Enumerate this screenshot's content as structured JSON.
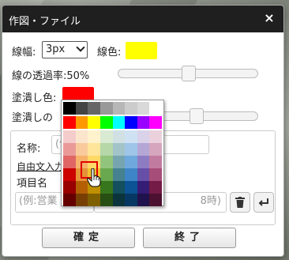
{
  "dialog": {
    "title": "作図・ファイル",
    "close_glyph": "×"
  },
  "line": {
    "width_label": "線幅:",
    "width_value": "3px",
    "color_label": "線色:",
    "color": "#ffff00"
  },
  "line_opacity": {
    "label": "線の透過率:50%",
    "value_percent": 50
  },
  "fill": {
    "label": "塗潰し色:",
    "color": "#ff0000"
  },
  "fill_opacity": {
    "label": "塗潰しの"
  },
  "attributes": {
    "name_label": "名称:",
    "name_placeholder": "(例",
    "free_input_link": "自由文入力",
    "item_name_label": "項目名",
    "item_placeholder": "(例:営業",
    "value_placeholder": "8時)"
  },
  "icons": {
    "trash": "trash-icon",
    "enter": "enter-icon"
  },
  "buttons": {
    "confirm": "確定",
    "close": "終了"
  },
  "palette": {
    "rows": [
      [
        "#000000",
        "#444444",
        "#666666",
        "#999999",
        "#b7b7b7",
        "#cccccc",
        "#d9d9d9",
        "#ffffff"
      ],
      [
        "#ff0000",
        "#ff9900",
        "#ffff00",
        "#00ff00",
        "#00ffff",
        "#0000ff",
        "#9900ff",
        "#ff00ff"
      ],
      [
        "#f4cccc",
        "#fce5cd",
        "#fff2cc",
        "#d9ead3",
        "#d0e0e3",
        "#cfe2f3",
        "#d9d2e9",
        "#ead1dc"
      ],
      [
        "#ea9999",
        "#f9cb9c",
        "#ffe599",
        "#b6d7a8",
        "#a2c4c9",
        "#9fc5e8",
        "#b4a7d6",
        "#d5a6bd"
      ],
      [
        "#e06666",
        "#f6b26b",
        "#ffd966",
        "#93c47d",
        "#76a5af",
        "#6fa8dc",
        "#8e7cc3",
        "#c27ba0"
      ],
      [
        "#cc0000",
        "#e69138",
        "#f1c232",
        "#6aa84f",
        "#45818e",
        "#3d85c6",
        "#674ea7",
        "#a64d79"
      ],
      [
        "#990000",
        "#b45f06",
        "#bf9000",
        "#38761d",
        "#134f5c",
        "#0b5394",
        "#351c75",
        "#741b47"
      ],
      [
        "#660000",
        "#783f04",
        "#7f6000",
        "#274e13",
        "#0c343d",
        "#073763",
        "#20124d",
        "#4c1130"
      ]
    ],
    "selected_color": "#ff9900"
  }
}
